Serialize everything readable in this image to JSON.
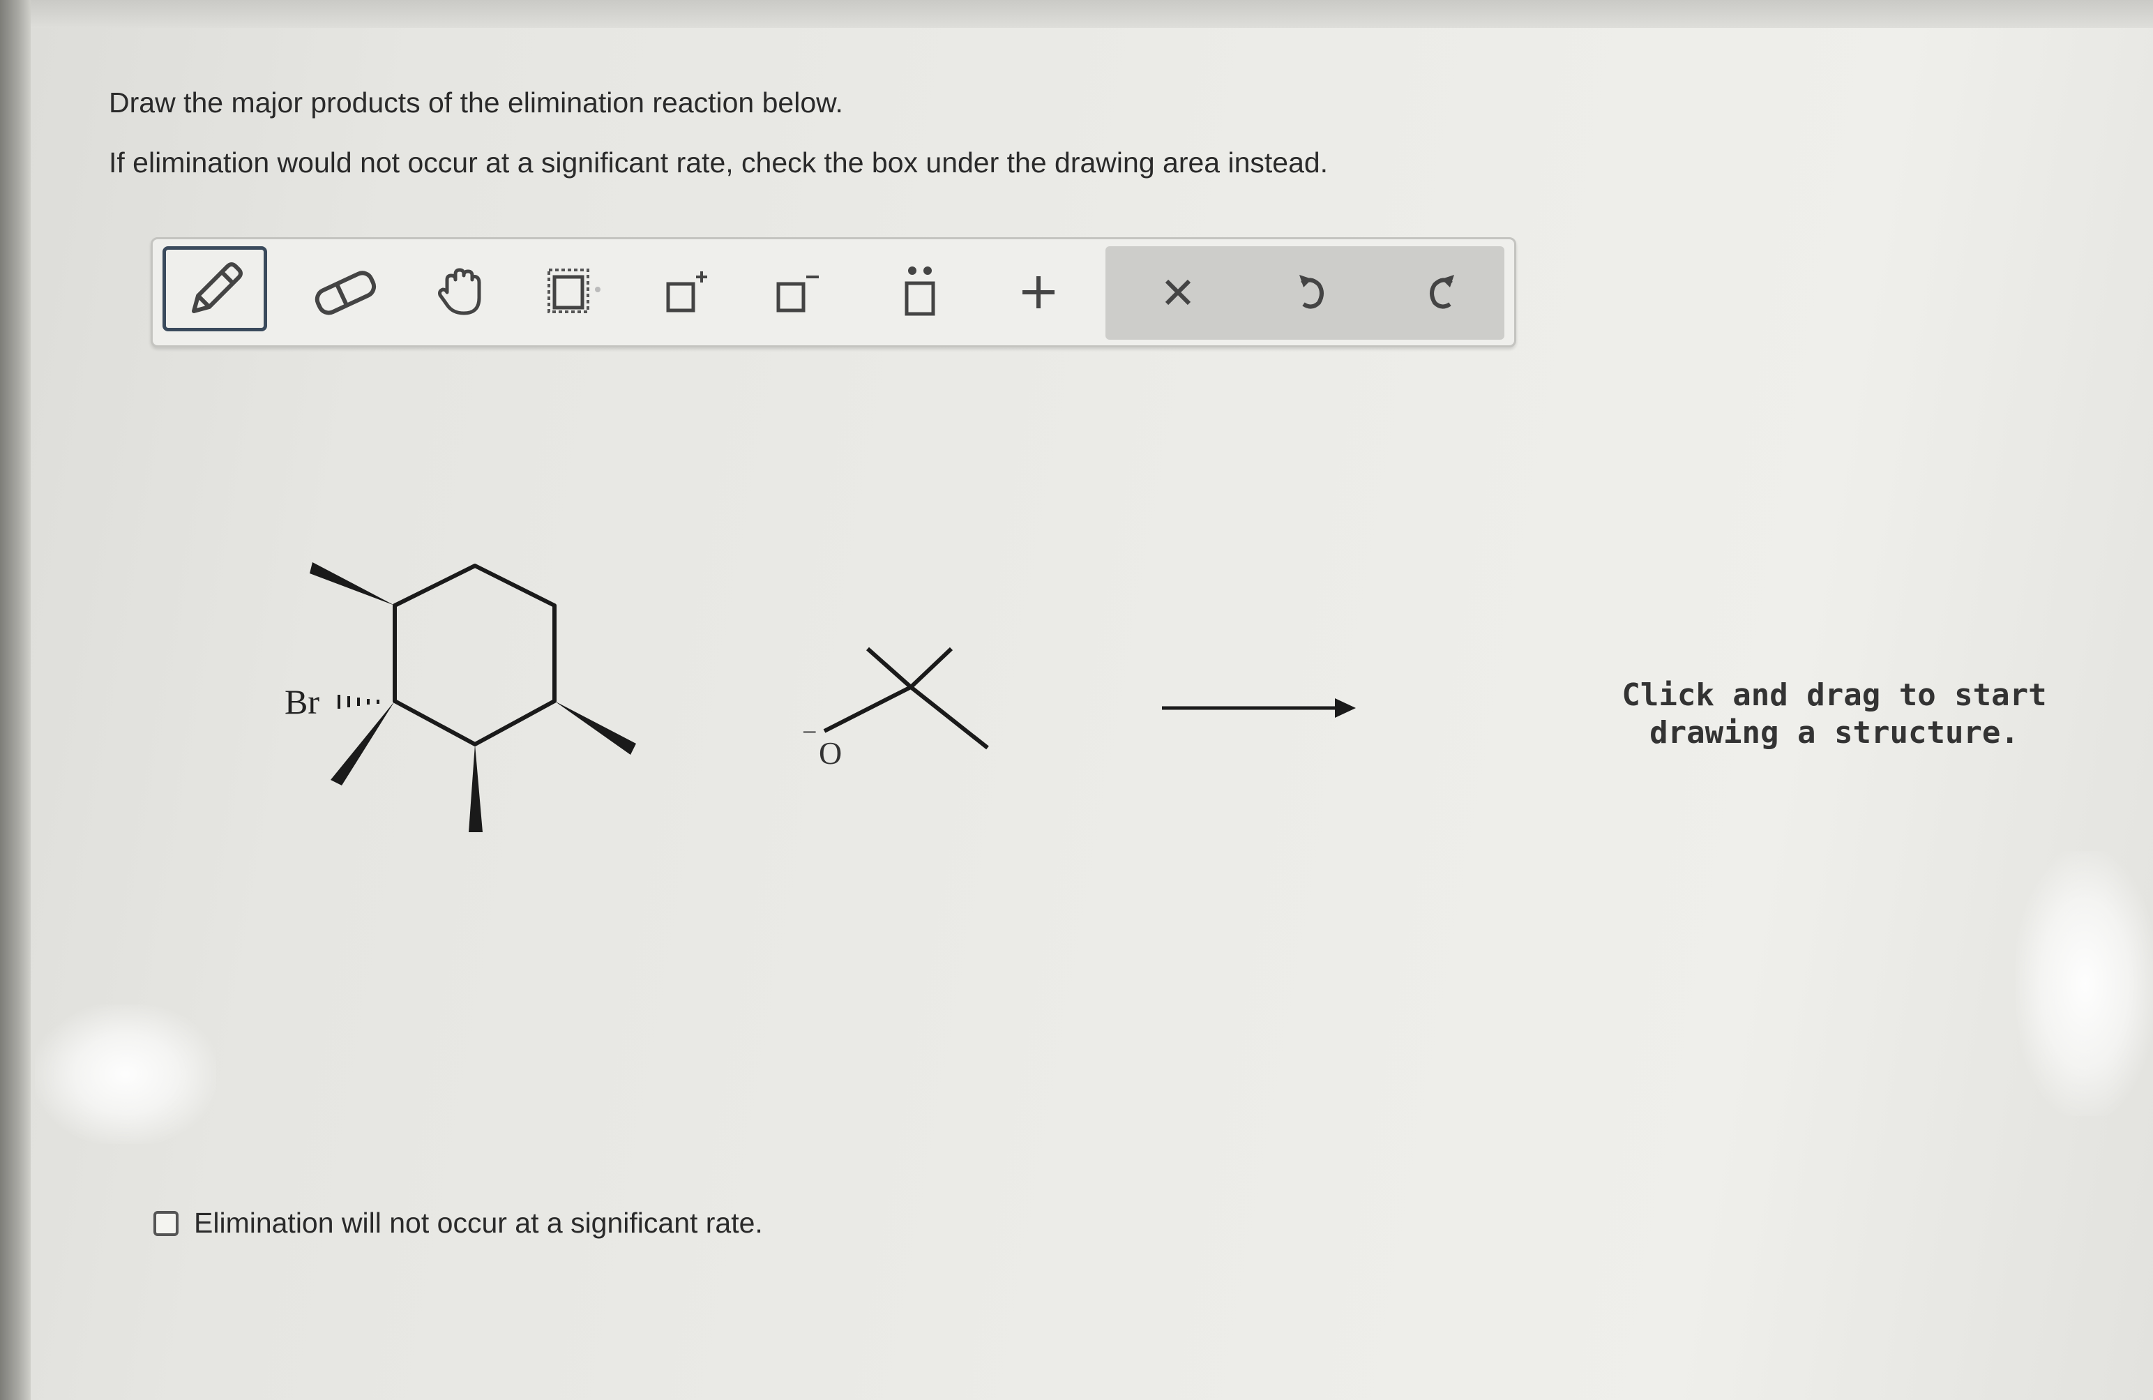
{
  "question": {
    "line1": "Draw the major products of the elimination reaction below.",
    "line2": "If elimination would not occur at a significant rate, check the box under the drawing area instead."
  },
  "toolbar": {
    "tools": [
      {
        "name": "pencil-icon",
        "selected": true
      },
      {
        "name": "eraser-icon",
        "selected": false
      },
      {
        "name": "hand-icon",
        "selected": false
      },
      {
        "name": "select-box-icon",
        "selected": false
      },
      {
        "name": "positive-charge-icon",
        "selected": false
      },
      {
        "name": "negative-charge-icon",
        "selected": false
      },
      {
        "name": "lone-pair-icon",
        "selected": false
      },
      {
        "name": "add-icon",
        "selected": false
      }
    ],
    "actions": [
      "clear-icon",
      "undo-icon",
      "redo-icon"
    ]
  },
  "reactant": {
    "substituent_label": "Br",
    "base_atom_label": "O",
    "base_charge": "−"
  },
  "drawing_area": {
    "hint": "Click and drag to start drawing a structure."
  },
  "no_elimination": {
    "label": "Elimination will not occur at a significant rate.",
    "checked": false
  },
  "colors": {
    "text": "#2a2a2a",
    "selected_tool_border": "#3a4a5c",
    "action_group_bg": "#cdcdca"
  }
}
